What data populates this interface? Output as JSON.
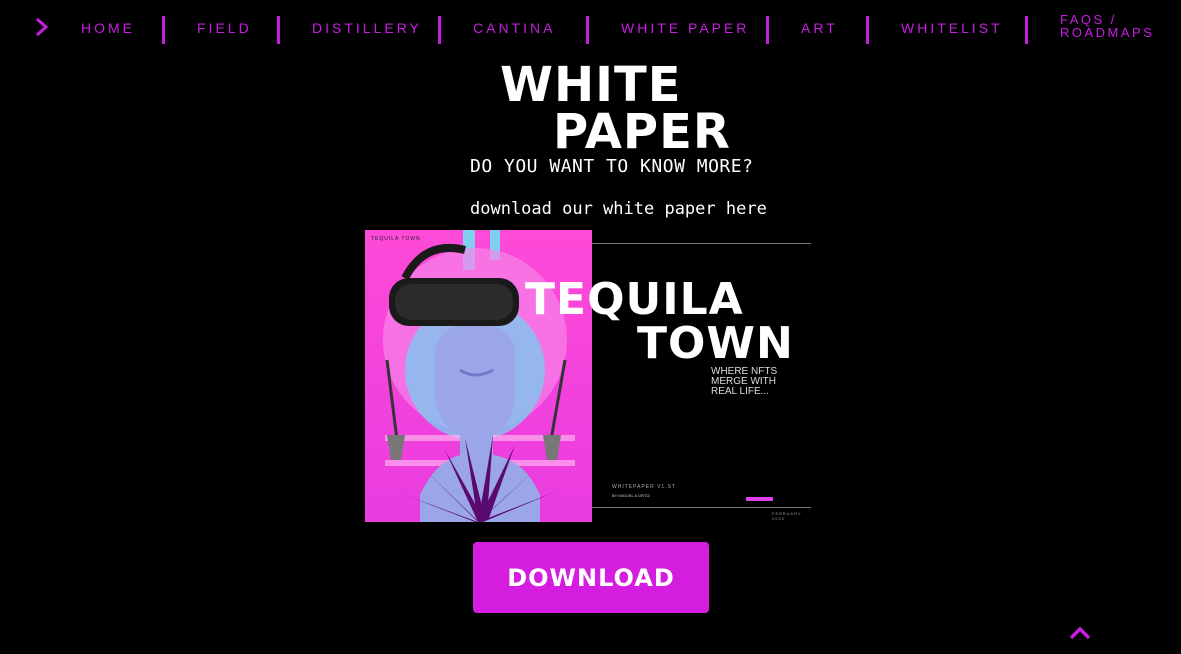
{
  "nav": {
    "items": [
      "HOME",
      "FIELD",
      "DISTILLERY",
      "CANTINA",
      "WHITE PAPER",
      "ART",
      "WHITELIST"
    ],
    "last_item_line1": "FAQS /",
    "last_item_line2": "ROADMAPS",
    "accent_color": "#c61ee0"
  },
  "heading": {
    "line1": "WHITE",
    "line2": "PAPER",
    "subtitle": "DO YOU WANT TO KNOW MORE?",
    "note": "download our white paper here"
  },
  "cover": {
    "brand_small": "TEQUILA TOWN",
    "title_line1": "TEQUILA",
    "title_line2": "TOWN",
    "tagline": "WHERE NFTS MERGE WITH REAL LIFE...",
    "version": "WHITEPAPER V1.ST",
    "author": "BY MIGUEL A ORTIZ",
    "date": "FEBRUARY 2022"
  },
  "download_button": {
    "label": "DOWNLOAD",
    "color": "#d41ddf"
  },
  "icons": {
    "menu_toggle": "chevron-right-icon",
    "back_to_top": "chevron-up-icon"
  }
}
